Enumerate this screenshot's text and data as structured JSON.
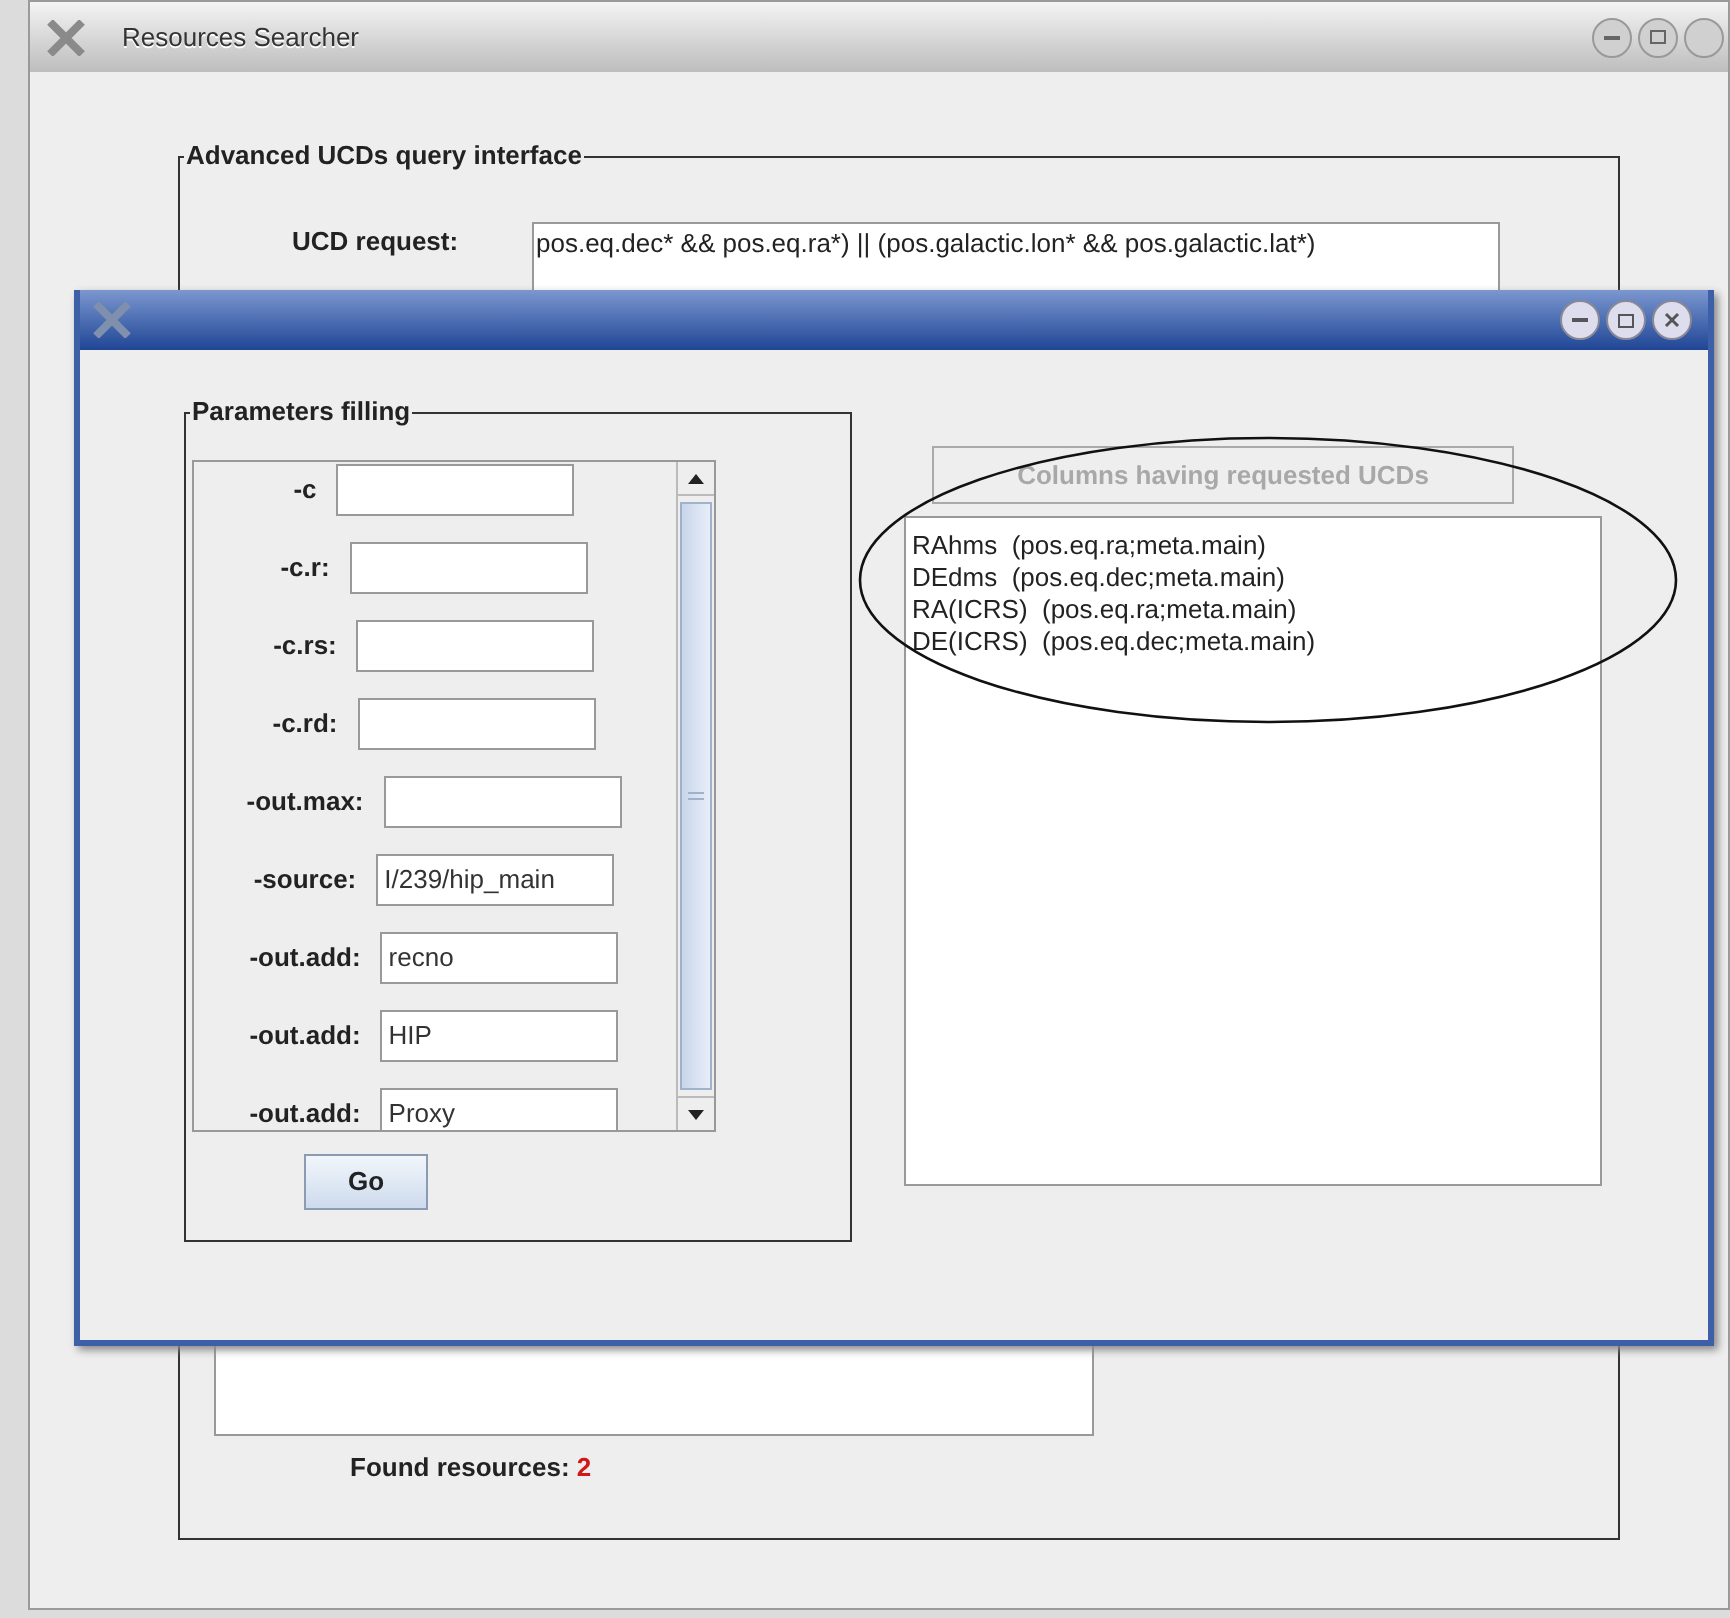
{
  "main_window": {
    "title": "Resources Searcher",
    "group_title": "Advanced UCDs query interface",
    "ucd_request": {
      "label": "UCD request:",
      "value": "pos.eq.dec* && pos.eq.ra*) || (pos.galactic.lon* && pos.galactic.lat*)"
    },
    "found_resources": {
      "label": "Found resources:",
      "count": "2"
    }
  },
  "dialog": {
    "parameters": {
      "title": "Parameters filling",
      "rows": [
        {
          "label": "-c",
          "value": ""
        },
        {
          "label": "-c.r:",
          "value": ""
        },
        {
          "label": "-c.rs:",
          "value": ""
        },
        {
          "label": "-c.rd:",
          "value": ""
        },
        {
          "label": "-out.max:",
          "value": ""
        },
        {
          "label": "-source:",
          "value": "I/239/hip_main"
        },
        {
          "label": "-out.add:",
          "value": "recno"
        },
        {
          "label": "-out.add:",
          "value": "HIP"
        },
        {
          "label": "-out.add:",
          "value": "Proxy"
        }
      ],
      "go_button": "Go"
    },
    "columns_button": {
      "label": "Columns having requested UCDs",
      "disabled": true
    },
    "columns": [
      "RAhms  (pos.eq.ra;meta.main)",
      "DEdms  (pos.eq.dec;meta.main)",
      "RA(ICRS)  (pos.eq.ra;meta.main)",
      "DE(ICRS)  (pos.eq.dec;meta.main)"
    ]
  }
}
